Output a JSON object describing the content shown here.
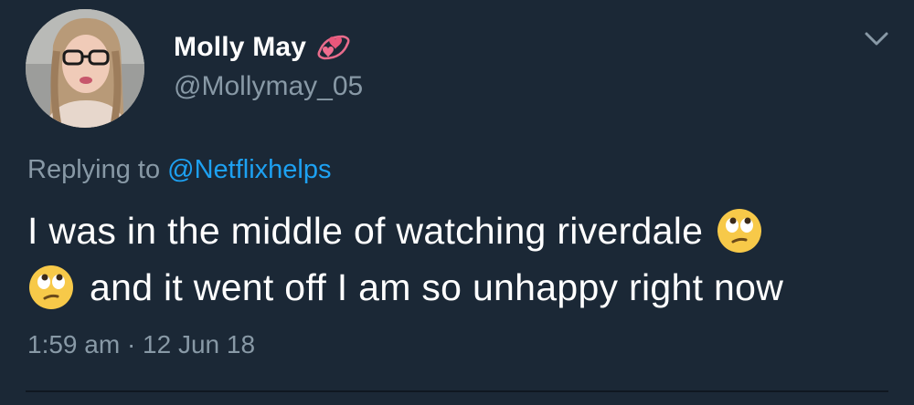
{
  "user": {
    "display_name": "Molly May",
    "handle": "@Mollymay_05"
  },
  "reply": {
    "prefix": "Replying to",
    "mention": "@Netflixhelps"
  },
  "tweet": {
    "line1_text": "I was in the middle of watching riverdale",
    "line2_text": "and it went off I am so unhappy right now"
  },
  "timestamp": "1:59 am · 12 Jun 18",
  "colors": {
    "background": "#1b2836",
    "primary_text": "#ffffff",
    "secondary_text": "#8899a6",
    "link": "#1da1f2"
  },
  "icons": {
    "name_emoji": "revolving-hearts-icon",
    "inline_emoji": "face-with-rolling-eyes-icon",
    "menu": "chevron-down-icon"
  }
}
